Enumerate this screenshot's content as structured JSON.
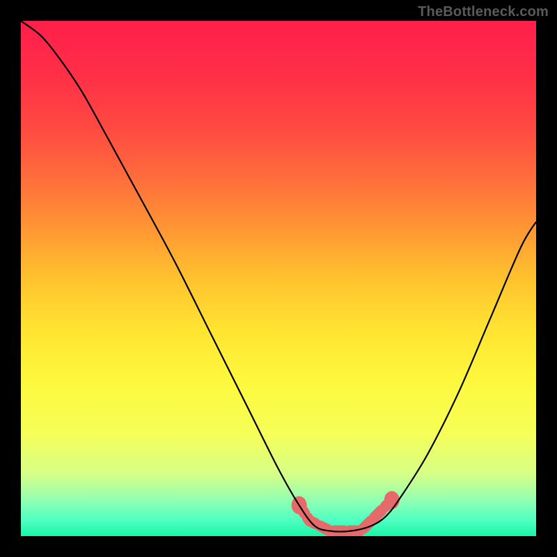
{
  "watermark": "TheBottleneck.com",
  "chart_data": {
    "type": "line",
    "title": "",
    "xlabel": "",
    "ylabel": "",
    "xlim": [
      0,
      100
    ],
    "ylim": [
      0,
      100
    ],
    "gradient_stops": [
      {
        "offset": 0,
        "color": "#ff1f4b"
      },
      {
        "offset": 10,
        "color": "#ff2e47"
      },
      {
        "offset": 20,
        "color": "#ff4742"
      },
      {
        "offset": 30,
        "color": "#ff6b3c"
      },
      {
        "offset": 40,
        "color": "#ff9534"
      },
      {
        "offset": 50,
        "color": "#ffc22e"
      },
      {
        "offset": 60,
        "color": "#ffe432"
      },
      {
        "offset": 70,
        "color": "#fdf83d"
      },
      {
        "offset": 80,
        "color": "#f6ff57"
      },
      {
        "offset": 88,
        "color": "#d6ff88"
      },
      {
        "offset": 93,
        "color": "#92ffb2"
      },
      {
        "offset": 97,
        "color": "#4dffc2"
      },
      {
        "offset": 100,
        "color": "#19f5a6"
      }
    ],
    "series": [
      {
        "name": "bottleneck-curve",
        "type": "line",
        "color": "#000000",
        "points": [
          {
            "x": 0,
            "y": 100
          },
          {
            "x": 4,
            "y": 97
          },
          {
            "x": 8,
            "y": 92
          },
          {
            "x": 12,
            "y": 86
          },
          {
            "x": 17,
            "y": 77
          },
          {
            "x": 23,
            "y": 66
          },
          {
            "x": 30,
            "y": 53
          },
          {
            "x": 37,
            "y": 39
          },
          {
            "x": 44,
            "y": 25
          },
          {
            "x": 50,
            "y": 13
          },
          {
            "x": 54,
            "y": 6
          },
          {
            "x": 57,
            "y": 2
          },
          {
            "x": 60,
            "y": 1
          },
          {
            "x": 64,
            "y": 1
          },
          {
            "x": 68,
            "y": 2
          },
          {
            "x": 71,
            "y": 4
          },
          {
            "x": 74,
            "y": 8
          },
          {
            "x": 79,
            "y": 16
          },
          {
            "x": 85,
            "y": 28
          },
          {
            "x": 91,
            "y": 42
          },
          {
            "x": 97,
            "y": 56
          },
          {
            "x": 100,
            "y": 61
          }
        ]
      },
      {
        "name": "optimal-range",
        "type": "marker-band",
        "color": "#e76a6a",
        "points": [
          {
            "x": 54,
            "y": 6
          },
          {
            "x": 56,
            "y": 3
          },
          {
            "x": 58,
            "y": 2
          },
          {
            "x": 60,
            "y": 1
          },
          {
            "x": 62,
            "y": 1
          },
          {
            "x": 64,
            "y": 1
          },
          {
            "x": 66,
            "y": 1
          },
          {
            "x": 68,
            "y": 3
          },
          {
            "x": 70,
            "y": 5
          },
          {
            "x": 72,
            "y": 7
          }
        ]
      }
    ]
  }
}
